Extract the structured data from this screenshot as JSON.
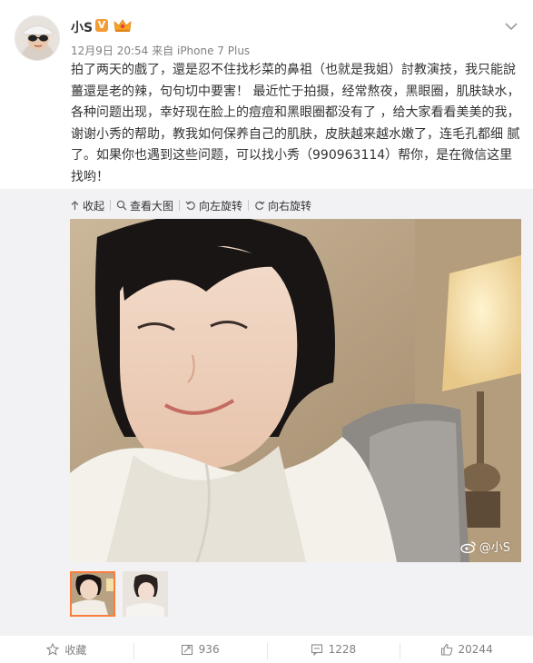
{
  "post": {
    "username": "小S",
    "verified_badge": "V",
    "timestamp": "12月9日 20:54",
    "source_prefix": "来自",
    "source_device": "iPhone 7 Plus",
    "text": "拍了两天的戲了，還是忍不住找杉菜的鼻祖（也就是我姐）討教演技，我只能說薑還是老的辣，句句切中要害！ 最近忙于拍摄，经常熬夜，黑眼圈，肌肤缺水，各种问题出现，幸好现在脸上的痘痘和黑眼圈都没有了 ，给大家看看美美的我，谢谢小秀的帮助，教我如何保养自己的肌肤，皮肤越来越水嫩了，连毛孔都细 腻了。如果你也遇到这些问题，可以找小秀（990963114）帮你，是在微信这里找哟！"
  },
  "media_toolbar": {
    "collapse": "收起",
    "view_large": "查看大图",
    "rotate_left": "向左旋转",
    "rotate_right": "向右旋转"
  },
  "photo": {
    "watermark": "@小S"
  },
  "actions": {
    "favorite": "收藏",
    "repost": "936",
    "comment": "1228",
    "like": "20244"
  },
  "colors": {
    "accent_orange": "#fa7d3c",
    "verified_badge": "#f39b35",
    "meta_gray": "#808080",
    "media_bg": "#f2f2f5"
  },
  "icons": [
    "chevron-down-icon",
    "member-crown-icon",
    "collapse-arrow-icon",
    "search-icon",
    "rotate-left-icon",
    "rotate-right-icon",
    "weibo-logo-icon",
    "star-icon",
    "repost-icon",
    "comment-icon",
    "like-icon"
  ]
}
